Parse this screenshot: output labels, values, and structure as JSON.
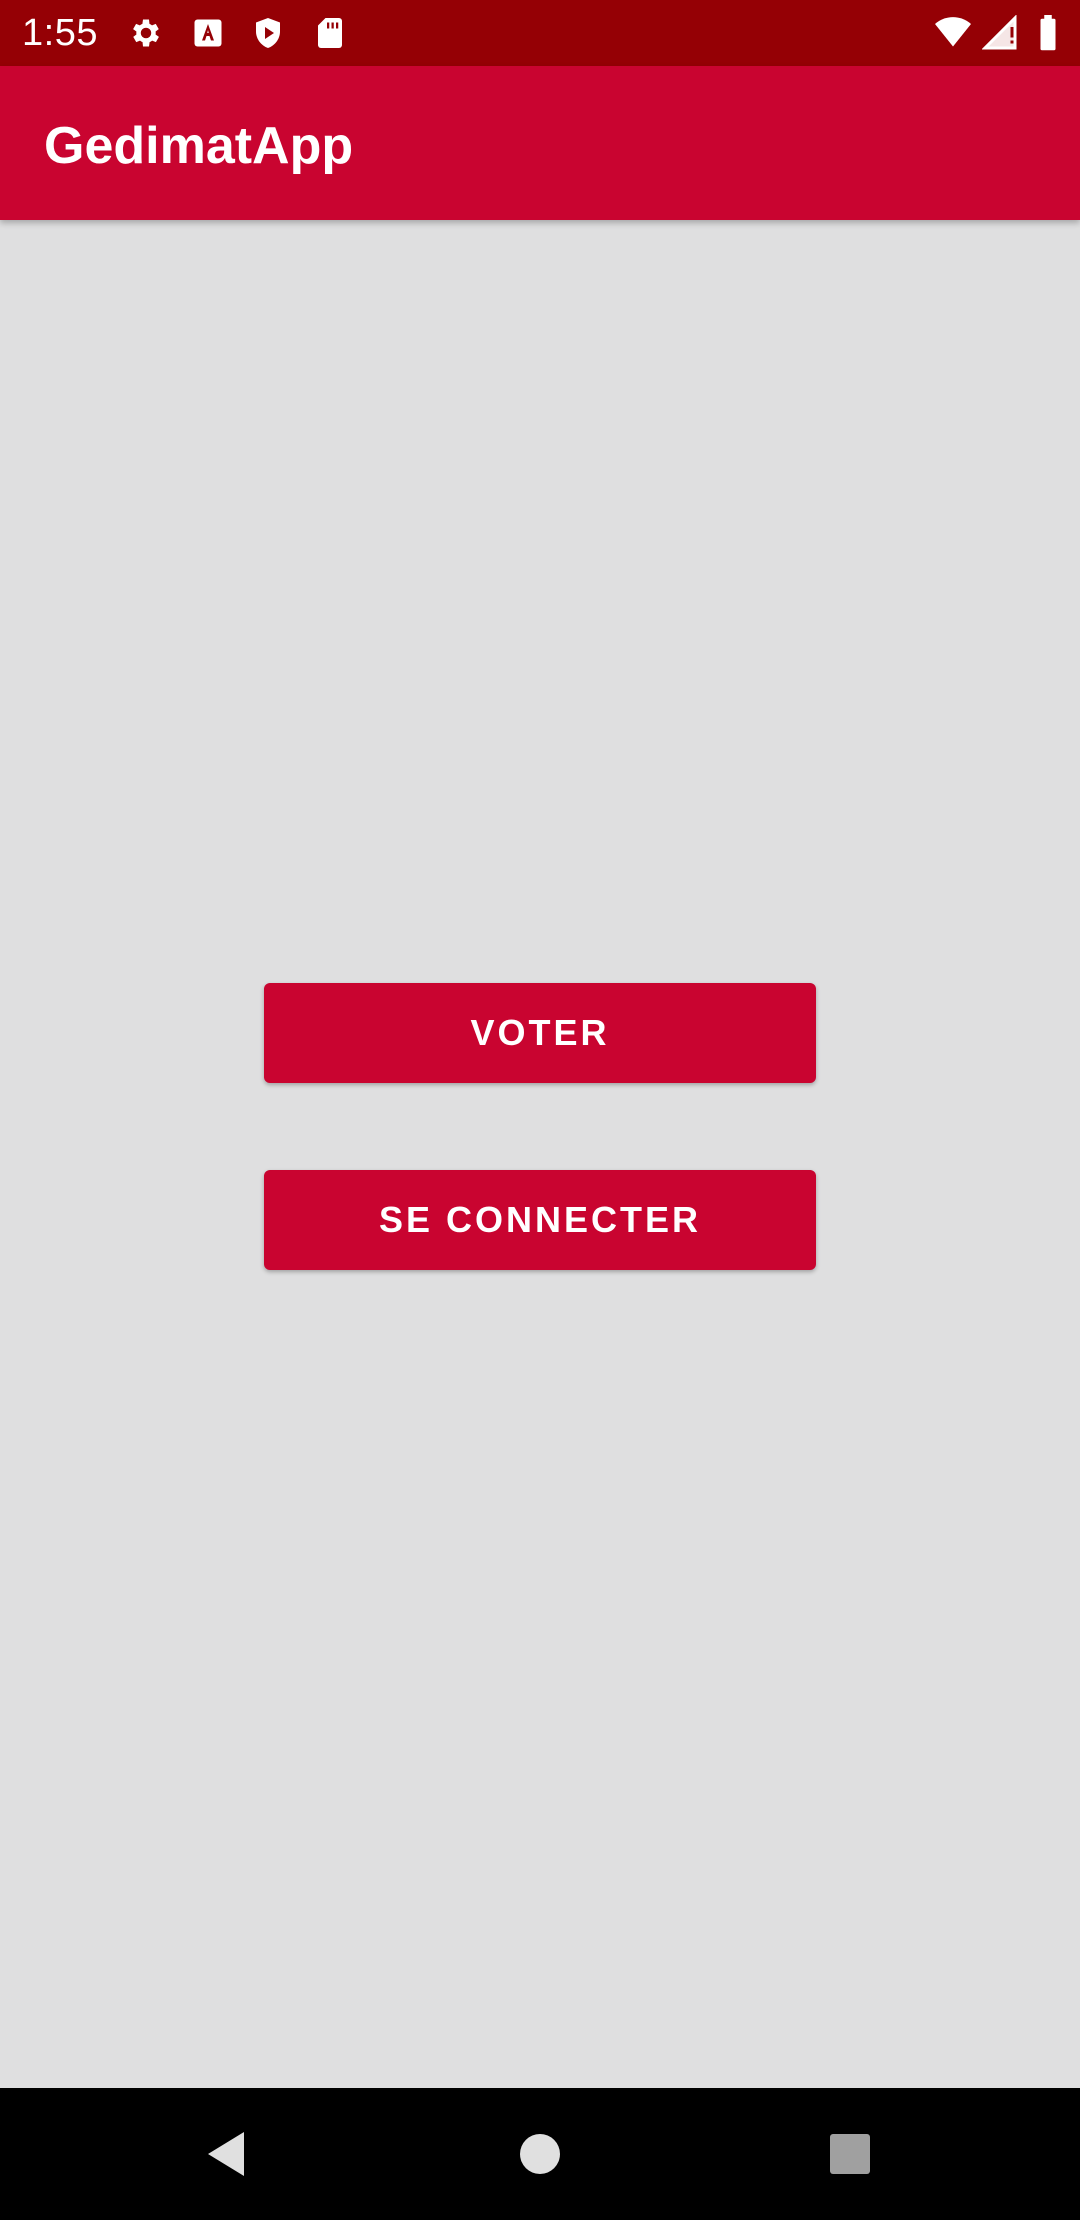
{
  "status_bar": {
    "time": "1:55",
    "icons": [
      "gear-icon",
      "font-a-icon",
      "play-shield-icon",
      "sd-card-icon",
      "wifi-icon",
      "signal-icon",
      "battery-icon"
    ]
  },
  "app_bar": {
    "title": "GedimatApp"
  },
  "main": {
    "buttons": [
      {
        "label": "VOTER"
      },
      {
        "label": "SE CONNECTER"
      }
    ]
  },
  "nav_bar": {
    "icons": [
      "back-icon",
      "home-icon",
      "recents-icon"
    ]
  },
  "colors": {
    "status_bar": "#950005",
    "primary": "#c90430",
    "background": "#dfdfe0",
    "nav_bar": "#000000"
  }
}
